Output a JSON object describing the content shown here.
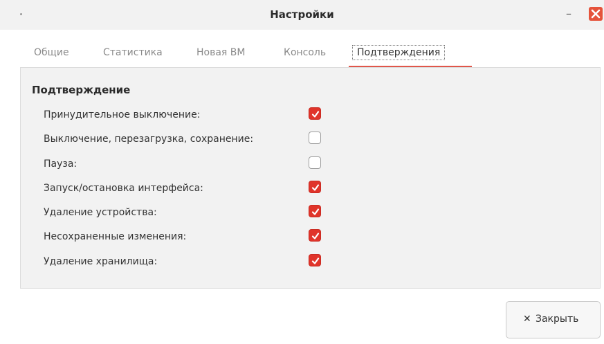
{
  "window": {
    "title": "Настройки",
    "minimize_glyph": "–"
  },
  "tabs": [
    {
      "label": "Общие",
      "active": false
    },
    {
      "label": "Статистика",
      "active": false
    },
    {
      "label": "Новая ВМ",
      "active": false
    },
    {
      "label": "Консоль",
      "active": false
    },
    {
      "label": "Подтверждения",
      "active": true
    }
  ],
  "section": {
    "title": "Подтверждение",
    "options": [
      {
        "label": "Принудительное выключение:",
        "checked": true
      },
      {
        "label": "Выключение, перезагрузка, сохранение:",
        "checked": false
      },
      {
        "label": "Пауза:",
        "checked": false
      },
      {
        "label": "Запуск/остановка интерфейса:",
        "checked": true
      },
      {
        "label": "Удаление устройства:",
        "checked": true
      },
      {
        "label": "Несохраненные изменения:",
        "checked": true
      },
      {
        "label": "Удаление хранилища:",
        "checked": true
      }
    ]
  },
  "footer": {
    "close_label": "Закрыть",
    "close_icon": "close-x-icon"
  },
  "colors": {
    "accent": "#e0342a",
    "tab_underline": "#e0564a",
    "panel_bg": "#f2f2f2"
  }
}
